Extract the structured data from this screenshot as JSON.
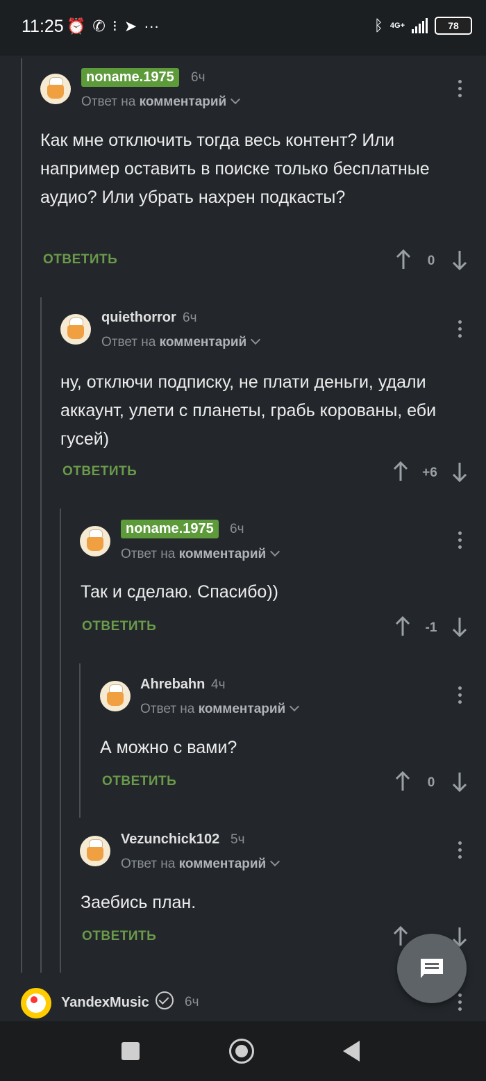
{
  "status_bar": {
    "time": "11:25",
    "network": "4G+",
    "battery": "78"
  },
  "comments": [
    {
      "author": "noname.1975",
      "author_highlighted": true,
      "time": "6ч",
      "reply_prefix": "Ответ на",
      "reply_target": "комментарий",
      "text": "Как мне отключить тогда весь контент? Или например оставить в поиске только бесплатные аудио? Или убрать нахрен подкасты?",
      "reply_label": "ОТВЕТИТЬ",
      "votes": "0"
    },
    {
      "author": "quiethorror",
      "author_highlighted": false,
      "time": "6ч",
      "reply_prefix": "Ответ на",
      "reply_target": "комментарий",
      "text": "ну, отключи подписку, не плати деньги, удали аккаунт, улети с планеты, грабь корованы, еби гусей)",
      "reply_label": "ОТВЕТИТЬ",
      "votes": "+6"
    },
    {
      "author": "noname.1975",
      "author_highlighted": true,
      "time": "6ч",
      "reply_prefix": "Ответ на",
      "reply_target": "комментарий",
      "text": "Так и сделаю. Спасибо))",
      "reply_label": "ОТВЕТИТЬ",
      "votes": "-1"
    },
    {
      "author": "Ahrebahn",
      "author_highlighted": false,
      "time": "4ч",
      "reply_prefix": "Ответ на",
      "reply_target": "комментарий",
      "text": "А можно с вами?",
      "reply_label": "ОТВЕТИТЬ",
      "votes": "0"
    },
    {
      "author": "Vezunchick102",
      "author_highlighted": false,
      "time": "5ч",
      "reply_prefix": "Ответ на",
      "reply_target": "комментарий",
      "text": "Заебись план.",
      "reply_label": "ОТВЕТИТЬ",
      "votes": ""
    }
  ],
  "next_post": {
    "author": "YandexMusic",
    "time": "6ч"
  }
}
